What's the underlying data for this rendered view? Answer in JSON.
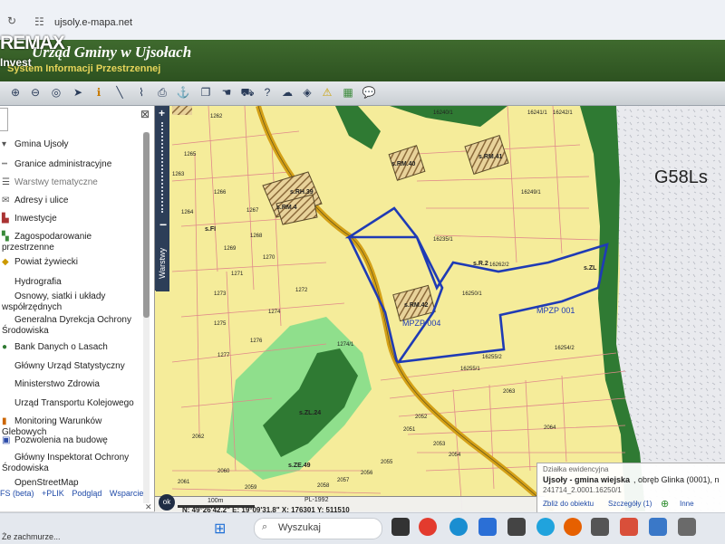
{
  "browser": {
    "url": "ujsoly.e-mapa.net",
    "icons": [
      "tune-icon"
    ]
  },
  "header": {
    "overlay_logo": "REMAX",
    "overlay_sub": "Invest",
    "title": "Urząd Gminy w Ujsołach",
    "subtitle": "System Informacji Przestrzennej"
  },
  "toolbar": {
    "icons": [
      "zoom-in-icon",
      "zoom-out-icon",
      "zoom-extent-icon",
      "pointer-icon",
      "info-icon",
      "measure-line-icon",
      "measure-area-icon",
      "print-icon",
      "anchor-icon",
      "copy-icon",
      "hand-icon",
      "car-icon",
      "help-icon",
      "upload-icon",
      "layers-icon",
      "warning-icon",
      "grid-icon",
      "comment-icon"
    ]
  },
  "panel": {
    "close_label": "⊠",
    "layers": [
      {
        "label": "Gmina Ujsoły",
        "icon": "emblem-icon"
      },
      {
        "label": "Granice administracyjne",
        "icon": "border-line-icon"
      },
      {
        "label": "Warstwy tematyczne",
        "icon": "layers-icon"
      },
      {
        "label": "Adresy i ulice",
        "icon": "envelope-icon"
      },
      {
        "label": "Inwestycje",
        "icon": "investment-icon"
      },
      {
        "label": "Zagospodarowanie przestrzenne",
        "icon": "planning-icon"
      },
      {
        "label": "Powiat żywiecki",
        "icon": "county-icon"
      },
      {
        "label": "Hydrografia",
        "icon": "water-icon"
      },
      {
        "label": "Osnowy, siatki i układy współrzędnych",
        "icon": "grid-icon"
      },
      {
        "label": "Generalna Dyrekcja Ochrony Środowiska",
        "icon": "gdos-icon"
      },
      {
        "label": "Bank Danych o Lasach",
        "icon": "forest-icon"
      },
      {
        "label": "Główny Urząd Statystyczny",
        "icon": "gus-icon"
      },
      {
        "label": "Ministerstwo Zdrowia",
        "icon": "health-icon"
      },
      {
        "label": "Urząd Transportu Kolejowego",
        "icon": "rail-icon"
      },
      {
        "label": "Monitoring Warunków Glebowych",
        "icon": "soil-icon"
      },
      {
        "label": "Pozwolenia na budowę",
        "icon": "permit-icon"
      },
      {
        "label": "Główny Inspektorat Ochrony Środowiska",
        "icon": "gios-icon"
      },
      {
        "label": "OpenStreetMap",
        "icon": "osm-icon"
      }
    ],
    "links": [
      "FS (beta)",
      "+PLIK",
      "Podgląd",
      "Wsparcie"
    ],
    "tab_label": "Warstwy"
  },
  "map": {
    "labels": {
      "big": "G58Ls",
      "mpzp004": "MPZP 004",
      "mpzp001": "MPZP 001",
      "rm40": "s.RM.40",
      "rm41": "s.RM.41",
      "rh39": "s.RH.39",
      "rm4": "s.RM.4",
      "rm42": "s.RM.42",
      "fi": "s.FI",
      "r2": "s.R.2",
      "zl": "s.ZL",
      "zl24": "s.ZL.24",
      "ze49": "s.ZE.49"
    },
    "parcels": [
      "1262",
      "1265",
      "1266",
      "1267",
      "1268",
      "1269",
      "1270",
      "1271",
      "1272",
      "1273",
      "1274",
      "1275",
      "1276",
      "1277",
      "1264",
      "1263",
      "1274/1",
      "16240/1",
      "16241/1",
      "16249/1",
      "16235/1",
      "16250/1",
      "16255/1",
      "16255/2",
      "2051",
      "2052",
      "2053",
      "2054",
      "2055",
      "2056",
      "2057",
      "2058",
      "2059",
      "2060",
      "2061",
      "2062",
      "2063",
      "2064",
      "16262/2",
      "16254/2",
      "16242/1"
    ],
    "colors": {
      "yellow": "#f5ec9a",
      "forest": "#2f7a33",
      "light_green": "#8fdf8c",
      "road": "#d4a017",
      "parcel_lines": "#e08a8a",
      "plan_border": "#1f3bb5",
      "hatch": "#8b6a3a"
    }
  },
  "status_bar": {
    "ok": "ok",
    "scale": "100m",
    "coords": "N: 49°26'42.2\"  E: 19°09'31.8\"  X: 176301  Y: 511510",
    "crs": "PL-1992"
  },
  "info_box": {
    "title": "Działka ewidencyjna",
    "municipality": "Ujsoły - gmina wiejska",
    "precinct": ", obręb Glinka (0001), n",
    "id": "241714_2.0001.16250/1",
    "actions": [
      "Zbliż do obiektu",
      "Szczegóły (1)",
      "Inne"
    ],
    "add_icon": "plus-circle-icon"
  },
  "taskbar": {
    "weather": "Że zachmurze...",
    "search_placeholder": "Wyszukaj",
    "apps": [
      {
        "name": "task-view-icon",
        "color": "#333333"
      },
      {
        "name": "chrome-icon",
        "color": "#e33b2e"
      },
      {
        "name": "edge-icon",
        "color": "#1a8ed1"
      },
      {
        "name": "mail-icon",
        "color": "#2b6fd6"
      },
      {
        "name": "store-icon",
        "color": "#444444"
      },
      {
        "name": "skype-icon",
        "color": "#20a3dd"
      },
      {
        "name": "firefox-icon",
        "color": "#e66000"
      },
      {
        "name": "calculator-icon",
        "color": "#555555"
      },
      {
        "name": "paint-icon",
        "color": "#d94f3a"
      },
      {
        "name": "photos-icon",
        "color": "#3a78c8"
      }
    ]
  }
}
